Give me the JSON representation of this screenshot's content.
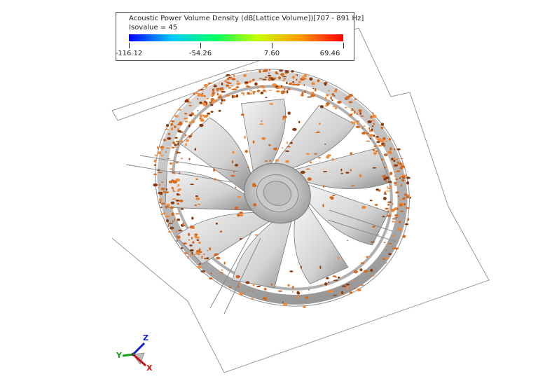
{
  "legend": {
    "title": "Acoustic Power Volume Density (dB[Lattice Volume])[707 - 891 Hz]",
    "isovalue": "Isovalue = 45",
    "ticks": [
      "-116.12",
      "-54.26",
      "7.60",
      "69.46"
    ],
    "colors": [
      "#0000ff",
      "#00c8ff",
      "#00ff66",
      "#c8ff00",
      "#ff9900",
      "#ff0000"
    ]
  },
  "axes": {
    "x_label": "X",
    "y_label": "Y",
    "z_label": "Z",
    "x_color": "#d01010",
    "y_color": "#10a010",
    "z_color": "#1020d0"
  },
  "scene": {
    "object": "fan-with-isosurface",
    "blade_count": 9,
    "isosurface_color": "#d2691e"
  }
}
